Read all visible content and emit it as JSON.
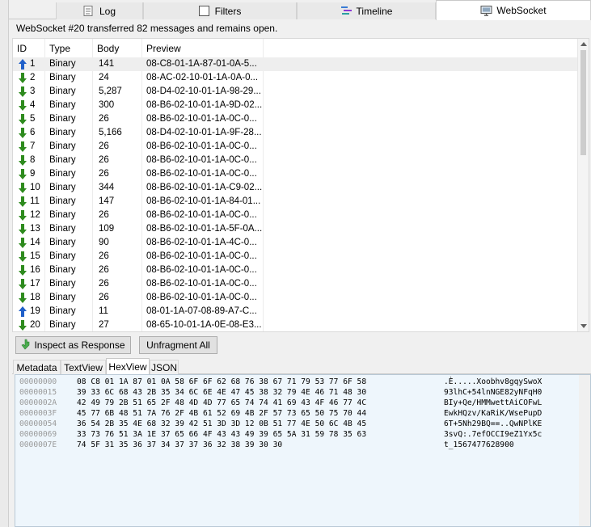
{
  "top_tabs": [
    {
      "label": "Log",
      "icon": "log-icon"
    },
    {
      "label": "Filters",
      "icon": "checkbox-icon"
    },
    {
      "label": "Timeline",
      "icon": "timeline-icon"
    },
    {
      "label": "WebSocket",
      "icon": "websocket-icon",
      "active": true
    }
  ],
  "info_text": "WebSocket #20 transferred 82 messages and remains open.",
  "columns": [
    "ID",
    "Type",
    "Body",
    "Preview"
  ],
  "messages": [
    {
      "id": "1",
      "dir": "up",
      "type": "Binary",
      "body": "141",
      "preview": "08-C8-01-1A-87-01-0A-5..."
    },
    {
      "id": "2",
      "dir": "down",
      "type": "Binary",
      "body": "24",
      "preview": "08-AC-02-10-01-1A-0A-0..."
    },
    {
      "id": "3",
      "dir": "down",
      "type": "Binary",
      "body": "5,287",
      "preview": "08-D4-02-10-01-1A-98-29..."
    },
    {
      "id": "4",
      "dir": "down",
      "type": "Binary",
      "body": "300",
      "preview": "08-B6-02-10-01-1A-9D-02..."
    },
    {
      "id": "5",
      "dir": "down",
      "type": "Binary",
      "body": "26",
      "preview": "08-B6-02-10-01-1A-0C-0..."
    },
    {
      "id": "6",
      "dir": "down",
      "type": "Binary",
      "body": "5,166",
      "preview": "08-D4-02-10-01-1A-9F-28..."
    },
    {
      "id": "7",
      "dir": "down",
      "type": "Binary",
      "body": "26",
      "preview": "08-B6-02-10-01-1A-0C-0..."
    },
    {
      "id": "8",
      "dir": "down",
      "type": "Binary",
      "body": "26",
      "preview": "08-B6-02-10-01-1A-0C-0..."
    },
    {
      "id": "9",
      "dir": "down",
      "type": "Binary",
      "body": "26",
      "preview": "08-B6-02-10-01-1A-0C-0..."
    },
    {
      "id": "10",
      "dir": "down",
      "type": "Binary",
      "body": "344",
      "preview": "08-B6-02-10-01-1A-C9-02..."
    },
    {
      "id": "11",
      "dir": "down",
      "type": "Binary",
      "body": "147",
      "preview": "08-B6-02-10-01-1A-84-01..."
    },
    {
      "id": "12",
      "dir": "down",
      "type": "Binary",
      "body": "26",
      "preview": "08-B6-02-10-01-1A-0C-0..."
    },
    {
      "id": "13",
      "dir": "down",
      "type": "Binary",
      "body": "109",
      "preview": "08-B6-02-10-01-1A-5F-0A..."
    },
    {
      "id": "14",
      "dir": "down",
      "type": "Binary",
      "body": "90",
      "preview": "08-B6-02-10-01-1A-4C-0..."
    },
    {
      "id": "15",
      "dir": "down",
      "type": "Binary",
      "body": "26",
      "preview": "08-B6-02-10-01-1A-0C-0..."
    },
    {
      "id": "16",
      "dir": "down",
      "type": "Binary",
      "body": "26",
      "preview": "08-B6-02-10-01-1A-0C-0..."
    },
    {
      "id": "17",
      "dir": "down",
      "type": "Binary",
      "body": "26",
      "preview": "08-B6-02-10-01-1A-0C-0..."
    },
    {
      "id": "18",
      "dir": "down",
      "type": "Binary",
      "body": "26",
      "preview": "08-B6-02-10-01-1A-0C-0..."
    },
    {
      "id": "19",
      "dir": "up",
      "type": "Binary",
      "body": "11",
      "preview": "08-01-1A-07-08-89-A7-C..."
    },
    {
      "id": "20",
      "dir": "down",
      "type": "Binary",
      "body": "27",
      "preview": "08-65-10-01-1A-0E-08-E3..."
    }
  ],
  "buttons": {
    "inspect": "Inspect as Response",
    "unfragment": "Unfragment All"
  },
  "bottom_tabs": [
    "Metadata",
    "TextView",
    "HexView",
    "JSON"
  ],
  "active_bottom_tab": "HexView",
  "hex_rows": [
    {
      "offset": "00000000",
      "bytes": "08 C8 01 1A 87 01 0A 58 6F 6F 62 68 76 38 67 71 79 53 77 6F 58",
      "ascii": ".È.....Xoobhv8gqySwoX"
    },
    {
      "offset": "00000015",
      "bytes": "39 33 6C 68 43 2B 35 34 6C 6E 4E 47 45 38 32 79 4E 46 71 48 30",
      "ascii": "93lhC+54lnNGE82yNFqH0"
    },
    {
      "offset": "0000002A",
      "bytes": "42 49 79 2B 51 65 2F 48 4D 4D 77 65 74 74 41 69 43 4F 46 77 4C",
      "ascii": "BIy+Qe/HMMwettAiCOFwL"
    },
    {
      "offset": "0000003F",
      "bytes": "45 77 6B 48 51 7A 76 2F 4B 61 52 69 4B 2F 57 73 65 50 75 70 44",
      "ascii": "EwkHQzv/KaRiK/WsePupD"
    },
    {
      "offset": "00000054",
      "bytes": "36 54 2B 35 4E 68 32 39 42 51 3D 3D 12 0B 51 77 4E 50 6C 4B 45",
      "ascii": "6T+5Nh29BQ==..QwNPlKE"
    },
    {
      "offset": "00000069",
      "bytes": "33 73 76 51 3A 1E 37 65 66 4F 43 43 49 39 65 5A 31 59 78 35 63",
      "ascii": "3svQ:.7efOCCI9eZ1Yx5c"
    },
    {
      "offset": "0000007E",
      "bytes": "74 5F 31 35 36 37 34 37 37 36 32 38 39 30 30",
      "ascii": "t_1567477628900"
    }
  ],
  "colors": {
    "up_arrow": "#1f5fc9",
    "down_arrow": "#2e8b1e",
    "hex_bg": "#eef6fc"
  }
}
